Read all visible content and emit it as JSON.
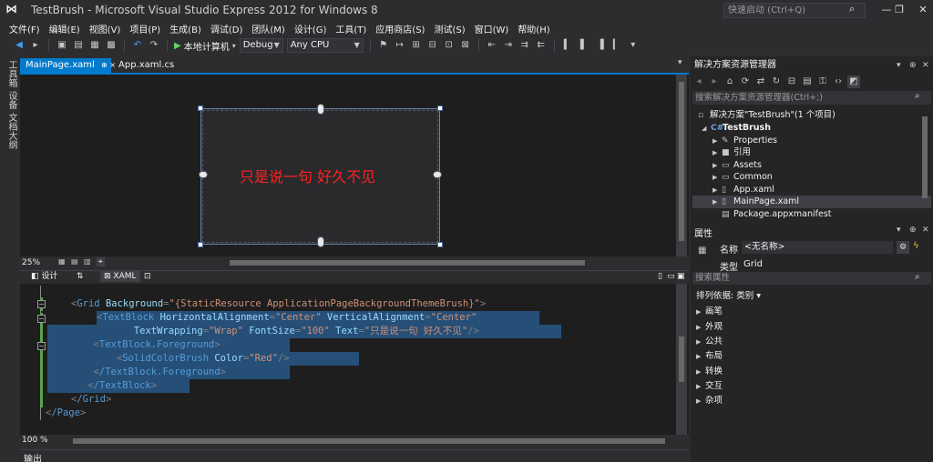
{
  "window": {
    "title": "TestBrush - Microsoft Visual Studio Express 2012 for Windows 8",
    "quick_launch_placeholder": "快速启动 (Ctrl+Q)"
  },
  "menu": [
    "文件(F)",
    "编辑(E)",
    "视图(V)",
    "项目(P)",
    "生成(B)",
    "调试(D)",
    "团队(M)",
    "设计(G)",
    "工具(T)",
    "应用商店(S)",
    "测试(S)",
    "窗口(W)",
    "帮助(H)"
  ],
  "toolbar": {
    "run_target": "本地计算机",
    "config": "Debug",
    "platform": "Any CPU"
  },
  "left_tool_tabs": [
    "工具箱",
    "设备",
    "文档大纲"
  ],
  "doc_tabs": [
    {
      "label": "MainPage.xaml",
      "pin": "⊕ ×",
      "active": true
    },
    {
      "label": "App.xaml.cs",
      "active": false
    }
  ],
  "designer": {
    "zoom": "25%",
    "text": "只是说一句 好久不见",
    "text_color": "#ff0000"
  },
  "split_tabs": {
    "design": "设计",
    "swap": "⇅",
    "xaml": "XAML"
  },
  "code": {
    "zoom": "100 %",
    "lines": [
      {
        "tag": "Grid",
        "attrs": [
          {
            "n": "Background",
            "v": "\"{StaticResource ApplicationPageBackgroundThemeBrush}\""
          }
        ]
      },
      {
        "tag": "TextBlock",
        "attrs": [
          {
            "n": "HorizontalAlignment",
            "v": "\"Center\""
          },
          {
            "n": "VerticalAlignment",
            "v": "\"Center\""
          }
        ]
      },
      {
        "attrs": [
          {
            "n": "TextWrapping",
            "v": "\"Wrap\""
          },
          {
            "n": "FontSize",
            "v": "\"100\""
          },
          {
            "n": "Text",
            "v": "\"只是说一句 好久不见\""
          }
        ]
      },
      {
        "tag": "TextBlock.Foreground"
      },
      {
        "tag": "SolidColorBrush",
        "attrs": [
          {
            "n": "Color",
            "v": "\"Red\""
          }
        ]
      },
      {
        "tag": "/TextBlock.Foreground"
      },
      {
        "tag": "/TextBlock"
      },
      {
        "tag": "/Grid"
      },
      {
        "tag": "/Page"
      }
    ]
  },
  "output_label": "输出",
  "solution_explorer": {
    "title": "解决方案资源管理器",
    "search_placeholder": "搜索解决方案资源管理器(Ctrl+;)",
    "items": [
      {
        "label": "解决方案\"TestBrush\"(1 个项目)"
      },
      {
        "label": "TestBrush"
      },
      {
        "label": "Properties"
      },
      {
        "label": "引用"
      },
      {
        "label": "Assets"
      },
      {
        "label": "Common"
      },
      {
        "label": "App.xaml"
      },
      {
        "label": "MainPage.xaml"
      },
      {
        "label": "Package.appxmanifest"
      }
    ]
  },
  "properties": {
    "title": "属性",
    "name_label": "名称",
    "name_value": "<无名称>",
    "type_label": "类型",
    "type_value": "Grid",
    "search_placeholder": "搜索属性",
    "sort_label": "排列依据: 类别 ▾",
    "categories": [
      "画笔",
      "外观",
      "公共",
      "布局",
      "转换",
      "交互",
      "杂项"
    ]
  }
}
